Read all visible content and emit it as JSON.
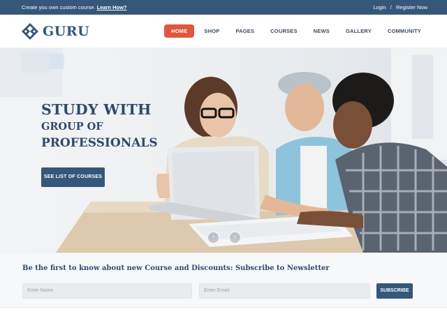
{
  "topbar": {
    "promo_text": "Create you own custom course.",
    "promo_link": "Learn How?",
    "login": "Login",
    "separator": "/",
    "register": "Register Now"
  },
  "header": {
    "logo_text": "GURU",
    "nav": [
      "HOME",
      "SHOP",
      "PAGES",
      "COURSES",
      "NEWS",
      "GALLERY",
      "COMMUNITY"
    ],
    "active_nav": "HOME"
  },
  "hero": {
    "title_line1": "STUDY WITH",
    "title_line2": "GROUP OF",
    "title_line3": "PROFESSIONALS",
    "button": "SEE LIST OF COURSES",
    "prev_arrow": "‹",
    "next_arrow": "›"
  },
  "newsletter": {
    "title": "Be the first to know about new Course and Discounts: Subscribe to Newsletter",
    "name_placeholder": "Enter Name",
    "email_placeholder": "Enter Email",
    "button": "SUBSCRIBE"
  },
  "colors": {
    "brand": "#35577a",
    "accent": "#e0563e"
  }
}
